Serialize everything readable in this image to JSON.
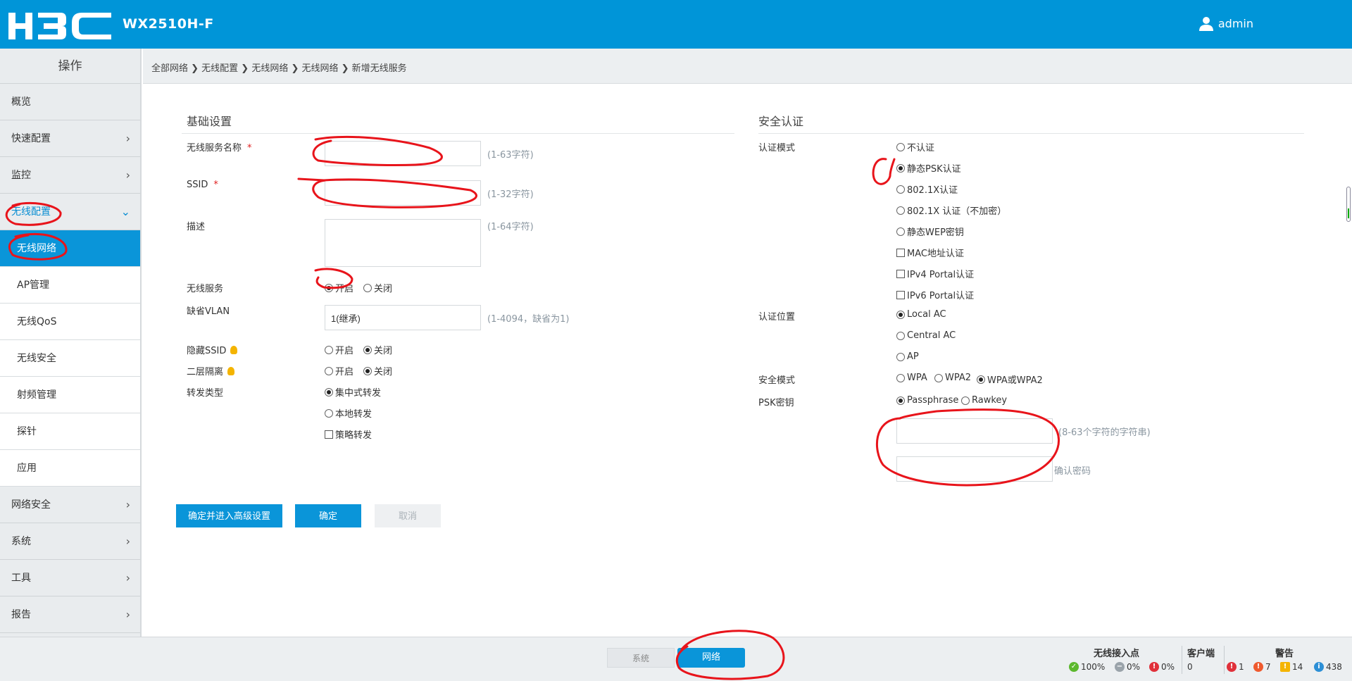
{
  "header": {
    "model": "WX2510H-F",
    "user": "admin"
  },
  "sidebar": {
    "title": "操作",
    "items": [
      {
        "label": "概览"
      },
      {
        "label": "快速配置",
        "chevron": "›"
      },
      {
        "label": "监控",
        "chevron": "›"
      },
      {
        "label": "无线配置",
        "chevron": "⌄"
      }
    ],
    "sub_items": [
      {
        "label": "无线网络"
      },
      {
        "label": "AP管理"
      },
      {
        "label": "无线QoS"
      },
      {
        "label": "无线安全"
      },
      {
        "label": "射频管理"
      },
      {
        "label": "探针"
      },
      {
        "label": "应用"
      }
    ],
    "bottom_items": [
      {
        "label": "网络安全",
        "chevron": "›"
      },
      {
        "label": "系统",
        "chevron": "›"
      },
      {
        "label": "工具",
        "chevron": "›"
      },
      {
        "label": "报告",
        "chevron": "›"
      }
    ]
  },
  "breadcrumb": "全部网络 ❯ 无线配置 ❯ 无线网络 ❯ 无线网络 ❯ 新增无线服务",
  "basic": {
    "title": "基础设置",
    "service_name_label": "无线服务名称",
    "service_name_value": "",
    "service_name_hint": "(1-63字符)",
    "ssid_label": "SSID",
    "ssid_value": "",
    "ssid_hint": "(1-32字符)",
    "desc_label": "描述",
    "desc_hint": "(1-64字符)",
    "required_mark": "*",
    "wireless_service_label": "无线服务",
    "on_label": "开启",
    "off_label": "关闭",
    "vlan_label": "缺省VLAN",
    "vlan_value": "1(继承)",
    "vlan_hint": "(1-4094，缺省为1)",
    "hide_ssid_label": "隐藏SSID",
    "l2_isolation_label": "二层隔离",
    "forward_label": "转发类型",
    "forward_central": "集中式转发",
    "forward_local": "本地转发",
    "forward_policy": "策略转发"
  },
  "security": {
    "title": "安全认证",
    "auth_mode_label": "认证模式",
    "auth_modes": [
      "不认证",
      "静态PSK认证",
      "802.1X认证",
      "802.1X 认证（不加密）",
      "静态WEP密钥"
    ],
    "auth_checks": [
      "MAC地址认证",
      "IPv4 Portal认证",
      "IPv6 Portal认证"
    ],
    "auth_pos_label": "认证位置",
    "auth_positions": [
      "Local AC",
      "Central AC",
      "AP"
    ],
    "sec_mode_label": "安全模式",
    "sec_modes": [
      "WPA",
      "WPA2",
      "WPA或WPA2"
    ],
    "psk_label": "PSK密钥",
    "psk_types": [
      "Passphrase",
      "Rawkey"
    ],
    "psk_hint": "(8-63个字符的字符串)",
    "confirm_label": "确认密码"
  },
  "buttons": {
    "advanced": "确定并进入高级设置",
    "ok": "确定",
    "cancel": "取消"
  },
  "footer": {
    "tab_system": "系统",
    "tab_network": "网络",
    "ap_head": "无线接入点",
    "client_head": "客户端",
    "alarm_head": "警告",
    "ap_ok": "100%",
    "ap_minus": "0%",
    "ap_err": "0%",
    "clients": "0",
    "alarm_1": "1",
    "alarm_2": "7",
    "alarm_3": "14",
    "alarm_4": "438"
  },
  "colors": {
    "brand": "#0095d8",
    "accent": "#0a95d9",
    "annotation": "#e8141b"
  }
}
